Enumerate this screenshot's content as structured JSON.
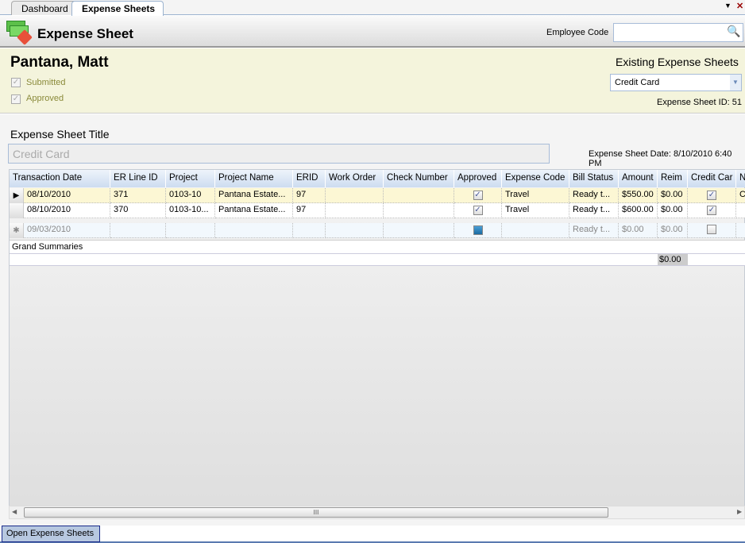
{
  "tabs": [
    {
      "label": "Dashboard"
    },
    {
      "label": "Expense Sheets"
    }
  ],
  "window_controls": {
    "menu": "▼",
    "close": "✕"
  },
  "header": {
    "title": "Expense Sheet",
    "employee_code_label": "Employee Code",
    "employee_code_value": "",
    "icon": "money-icon"
  },
  "employee": {
    "name": "Pantana, Matt",
    "submitted_label": "Submitted",
    "approved_label": "Approved",
    "submitted": true,
    "approved": true
  },
  "existing": {
    "label": "Existing Expense Sheets",
    "selected": "Credit Card",
    "sheet_id": "Expense Sheet ID: 51"
  },
  "form": {
    "title_label": "Expense Sheet Title",
    "title_value": "Credit Card",
    "date_text": "Expense Sheet Date: 8/10/2010 6:40 PM"
  },
  "grid": {
    "columns": [
      "Transaction Date",
      "ER Line ID",
      "Project",
      "Project Name",
      "ERID",
      "Work Order",
      "Check Number",
      "Approved",
      "Expense Code",
      "Bill Status",
      "Amount",
      "Reim",
      "Credit Car",
      "N"
    ],
    "rows": [
      {
        "cells": [
          "08/10/2010",
          "371",
          "0103-10",
          "Pantana  Estate...",
          "97",
          "",
          "",
          "✓",
          "Travel",
          "Ready t...",
          "$550.00",
          "$0.00",
          "✓",
          "C"
        ]
      },
      {
        "cells": [
          "08/10/2010",
          "370",
          "0103-10...",
          "Pantana  Estate...",
          "97",
          "",
          "",
          "✓",
          "Travel",
          "Ready t...",
          "$600.00",
          "$0.00",
          "✓",
          ""
        ]
      }
    ],
    "new_row": {
      "cells": [
        "09/03/2010",
        "",
        "",
        "",
        "",
        "",
        "",
        "■",
        "",
        "Ready t...",
        "$0.00",
        "$0.00",
        "",
        ""
      ]
    },
    "grand_summaries_label": "Grand Summaries",
    "reim_total": "$0.00"
  },
  "scrollbar": {
    "grip": "III"
  },
  "bottom_tab": {
    "label": "Open Expense Sheets"
  }
}
